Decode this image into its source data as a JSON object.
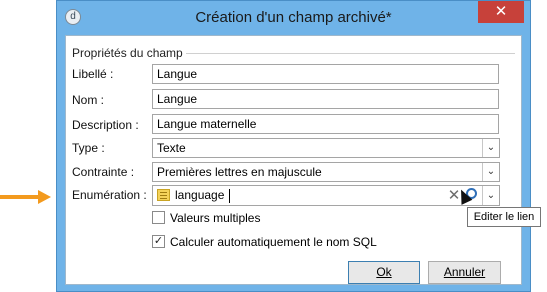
{
  "window": {
    "title": "Création d'un champ archivé*",
    "close_symbol": "✕",
    "app_icon": "d"
  },
  "group": {
    "title": "Propriétés du champ"
  },
  "fields": {
    "libelle": {
      "label": "Libellé :",
      "value": "Langue"
    },
    "nom": {
      "label": "Nom :",
      "value": "Langue"
    },
    "description": {
      "label": "Description :",
      "value": "Langue maternelle"
    },
    "type": {
      "label": "Type :",
      "value": "Texte"
    },
    "contrainte": {
      "label": "Contrainte :",
      "value": "Premières lettres en majuscule"
    },
    "enumeration": {
      "label": "Enumération :",
      "value": "language"
    }
  },
  "checkboxes": {
    "valeurs_multiples": {
      "label": "Valeurs multiples",
      "checked": false
    },
    "calcul_sql": {
      "label": "Calculer automatiquement le nom SQL",
      "checked": true,
      "mark": "✓"
    }
  },
  "buttons": {
    "ok": "Ok",
    "annuler": "Annuler"
  },
  "tooltip": {
    "text": "Editer le lien"
  },
  "icons": {
    "clear": "✕",
    "dropdown": "⌄"
  },
  "colors": {
    "annotation_arrow": "#f39a1e",
    "title_bar": "#6fb3e8",
    "close_button": "#c7413a"
  }
}
